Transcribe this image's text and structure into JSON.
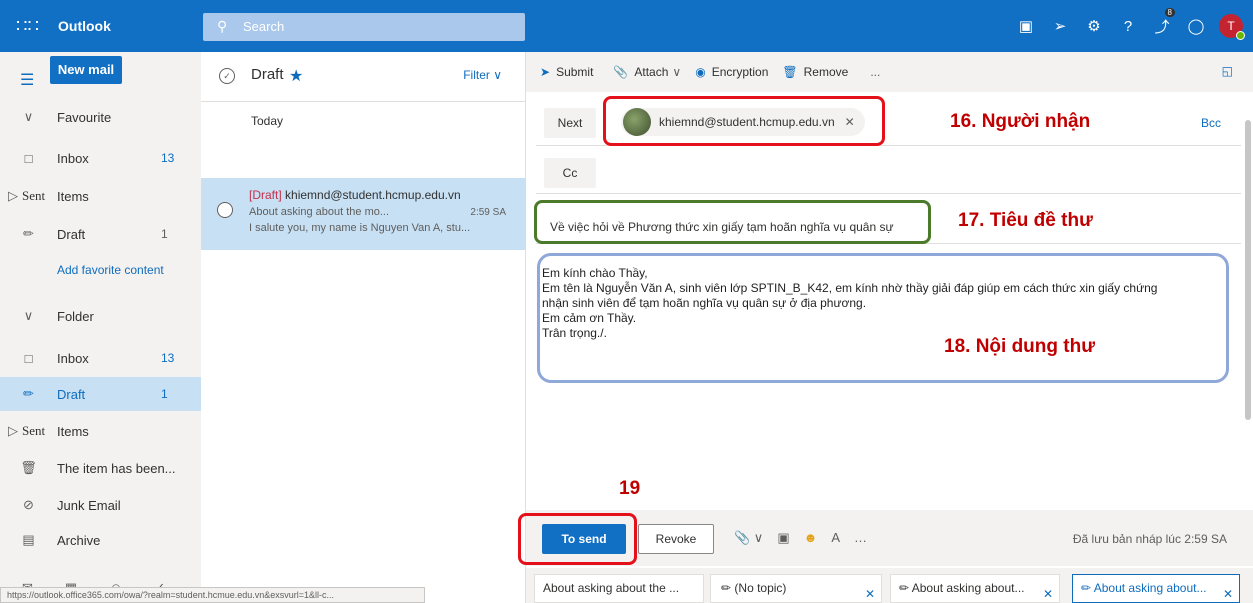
{
  "app": {
    "name": "Outlook"
  },
  "search": {
    "placeholder": "Search"
  },
  "topbar_icons": [
    "meet-icon",
    "teams-icon",
    "settings-icon",
    "help-icon",
    "feedback-icon",
    "notification-icon"
  ],
  "topbar_badge": "8",
  "user": {
    "initial": "T",
    "status_color": "#6bb700"
  },
  "colors": {
    "brand": "#1170c4",
    "selected": "#c7e0f4",
    "annotation": "#c00000"
  },
  "leftnav": {
    "new_mail": "New mail",
    "favourite_header": "Favourite",
    "favourites": [
      {
        "label": "Inbox",
        "count": "13"
      },
      {
        "label": "Sent",
        "suffix": "Items",
        "count": ""
      },
      {
        "label": "Draft",
        "count": "1"
      }
    ],
    "add_favorite": "Add favorite content",
    "folder_header": "Folder",
    "folders": [
      {
        "label": "Inbox",
        "count": "13"
      },
      {
        "label": "Draft",
        "count": "1"
      },
      {
        "label": "Sent",
        "suffix": "Items",
        "count": ""
      },
      {
        "label": "The item has been...",
        "count": ""
      },
      {
        "label": "Junk Email",
        "count": ""
      },
      {
        "label": "Archive",
        "count": ""
      }
    ]
  },
  "status_url": "https://outlook.office365.com/owa/?realm=student.hcmue.edu.vn&exsvurl=1&ll-c...",
  "message_list": {
    "title": "Draft",
    "filter": "Filter",
    "group": "Today",
    "item": {
      "tag": "[Draft]",
      "from": "khiemnd@student.hcmup.edu.vn",
      "subject": "About asking about the mo...",
      "time": "2:59 SA",
      "preview": "I salute you, my name is Nguyen Van A, stu..."
    }
  },
  "compose": {
    "commands": {
      "submit": "Submit",
      "attach": "Attach",
      "encryption": "Encryption",
      "remove": "Remove",
      "more": "..."
    },
    "to_button": "Next",
    "recipient": "khiemnd@student.hcmup.edu.vn",
    "cc_button": "Cc",
    "bcc": "Bcc",
    "subject": "Về việc hỏi về Phương thức xin giấy tạm hoãn nghĩa vụ quân sự",
    "body_lines": [
      "Em kính chào Thầy,",
      "Em tên là Nguyễn Văn A, sinh viên lớp SPTIN_B_K42, em kính nhờ thầy giải đáp giúp em cách thức xin giấy chứng",
      "nhận sinh viên để tạm hoãn nghĩa vụ quân sự ở địa phương.",
      "Em cảm ơn Thầy.",
      "Trân trọng./."
    ],
    "send": "To send",
    "revoke": "Revoke",
    "saved": "Đã lưu bản nháp lúc 2:59 SA"
  },
  "draft_tabs": [
    {
      "label": "About asking about the ..."
    },
    {
      "label": "(No topic)"
    },
    {
      "label": "About asking about..."
    },
    {
      "label": "About asking about..."
    }
  ],
  "annotations": {
    "recipient": "16. Người nhận",
    "subject": "17. Tiêu đề thư",
    "body": "18. Nội dung thư",
    "send": "19"
  }
}
